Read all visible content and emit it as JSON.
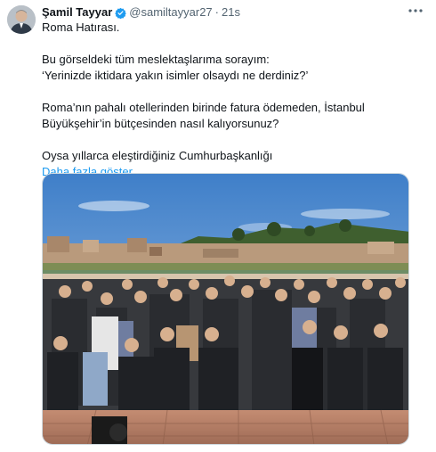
{
  "tweet": {
    "author_name": "Şamil Tayyar",
    "handle": "@samiltayyar27",
    "separator": "·",
    "time": "21s",
    "verified_icon": "verified-badge-icon",
    "more_icon": "more-icon",
    "lines": {
      "l1": "Roma Hatırası.",
      "l2": "Bu görseldeki tüm meslektaşlarıma sorayım:",
      "l3": "‘Yerinizde iktidara yakın isimler olsaydı ne derdiniz?’",
      "l4": "Roma’nın pahalı otellerinden birinde fatura ödemeden, İstanbul",
      "l5": "Büyükşehir’in bütçesinden nasıl kalıyorsunuz?",
      "l6": "Oysa yıllarca eleştirdiğiniz Cumhurbaşkanlığı"
    },
    "show_more": "Daha fazla göster"
  },
  "colors": {
    "link": "#1d9bf0",
    "verified": "#1d9bf0",
    "sky": "#5a8fd0",
    "terrace": "#b9826a"
  }
}
